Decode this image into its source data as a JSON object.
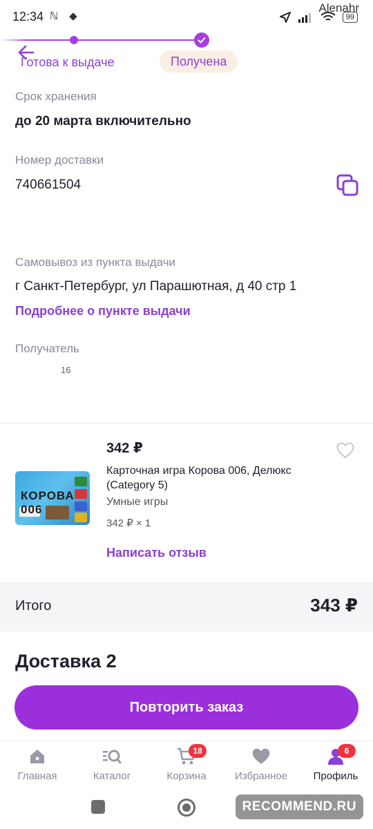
{
  "status_bar": {
    "time": "12:34",
    "left_icons": "ℕ ◆",
    "battery": "99",
    "watermark_user": "Alenahr"
  },
  "order_progress": {
    "previous_stage": "Готова к выдаче",
    "current_stage": "Получена"
  },
  "storage": {
    "label": "Срок хранения",
    "value": "до 20 марта включительно"
  },
  "delivery_number": {
    "label": "Номер доставки",
    "value": "740661504"
  },
  "pickup": {
    "label": "Самовывоз из пункта выдачи",
    "address": "г Санкт-Петербург, ул Парашютная, д 40 стр 1",
    "more_link": "Подробнее о пункте выдачи"
  },
  "recipient": {
    "label": "Получатель",
    "value": "16"
  },
  "product": {
    "price": "342 ₽",
    "title": "Карточная игра Корова 006, Делюкс (Category 5)",
    "brand": "Умные игры",
    "quantity_line": "342 ₽ × 1",
    "review_link": "Написать отзыв",
    "image_brand_text": "КОРОВА 006"
  },
  "total": {
    "label": "Итого",
    "value": "343 ₽"
  },
  "delivery_section": {
    "title": "Доставка 2"
  },
  "actions": {
    "repeat_order": "Повторить заказ"
  },
  "bottom_nav": {
    "items": [
      {
        "label": "Главная",
        "icon": "home-icon"
      },
      {
        "label": "Каталог",
        "icon": "catalog-search-icon"
      },
      {
        "label": "Корзина",
        "icon": "cart-icon",
        "badge": "18"
      },
      {
        "label": "Избранное",
        "icon": "heart-icon"
      },
      {
        "label": "Профиль",
        "icon": "profile-icon",
        "badge": "6"
      }
    ]
  },
  "watermark": "RECOMMEND.RU",
  "colors": {
    "accent": "#9c2fdc",
    "accent_text": "#8b3fd6",
    "badge": "#f0323f",
    "pill_bg": "#fbeee4"
  }
}
